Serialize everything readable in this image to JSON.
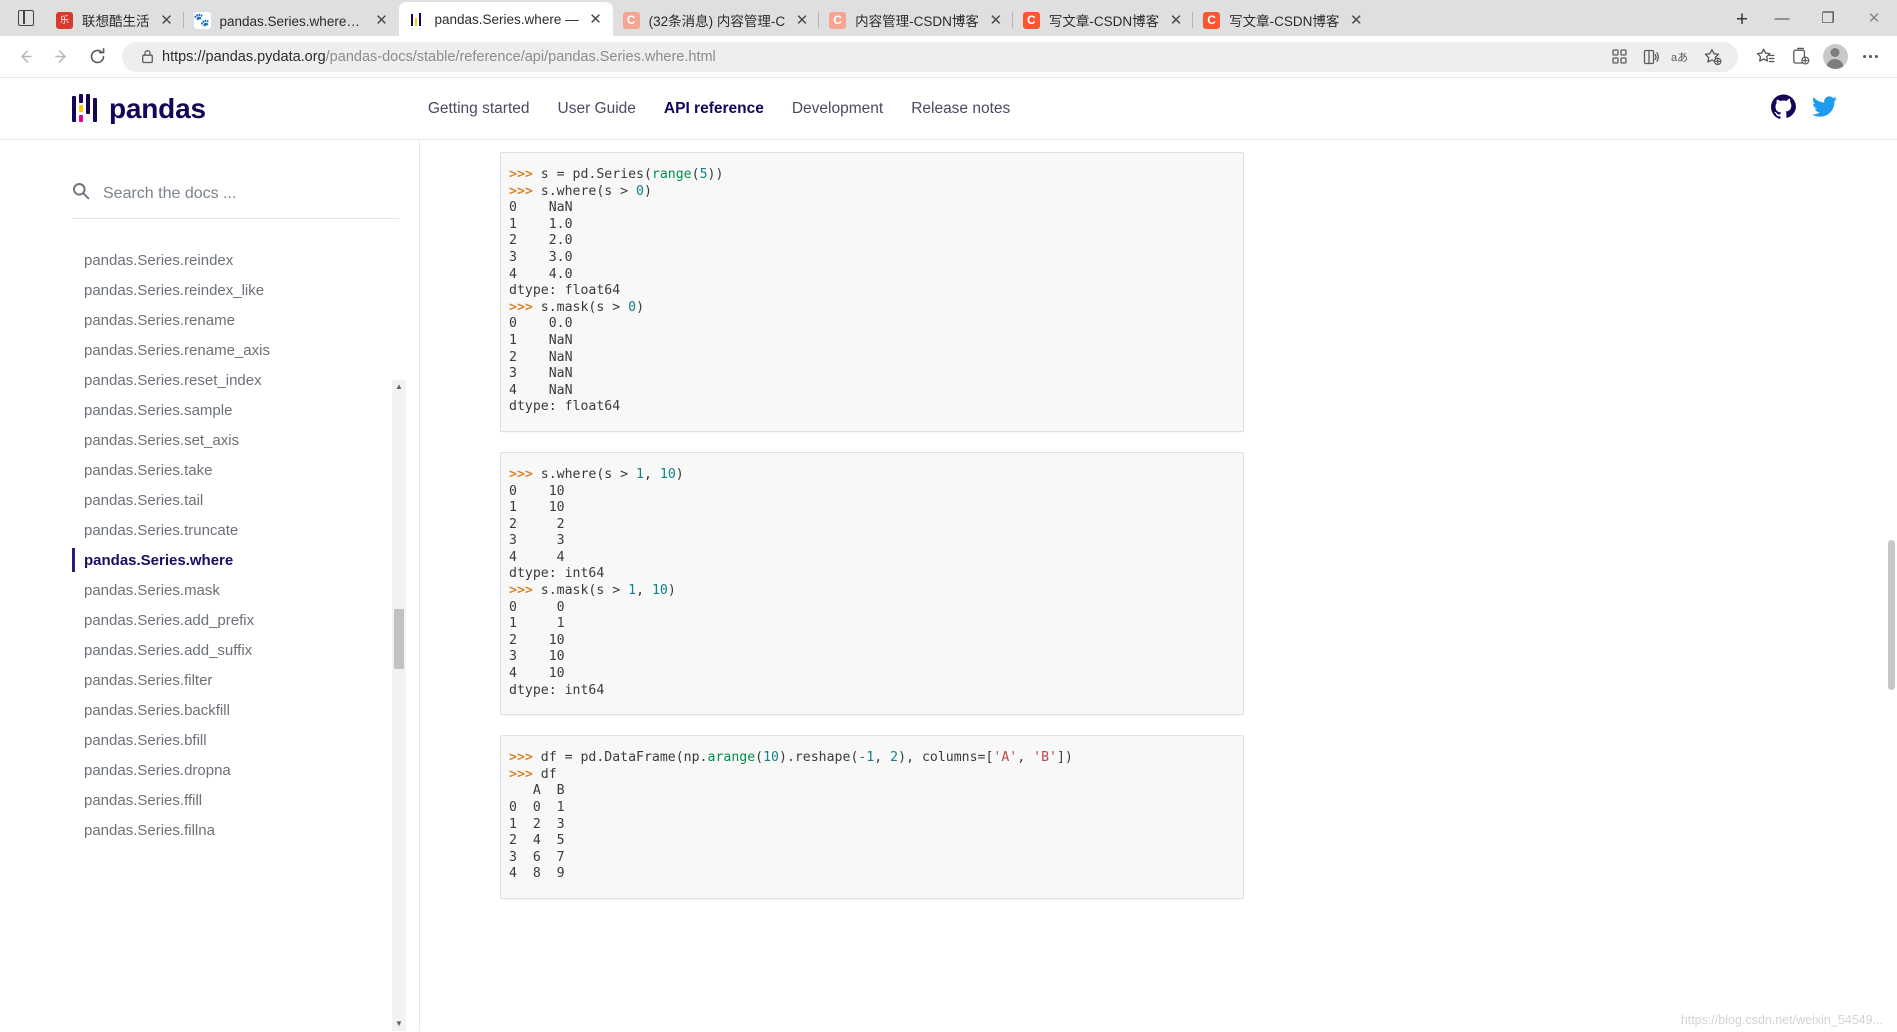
{
  "browser": {
    "tabs": [
      {
        "title": "联想酷生活",
        "favicon": "lenovo-icon",
        "active": false
      },
      {
        "title": "pandas.Series.where_百",
        "favicon": "baidu-icon",
        "active": false
      },
      {
        "title": "pandas.Series.where —",
        "favicon": "pandas-icon",
        "active": true
      },
      {
        "title": "(32条消息) 内容管理-C",
        "favicon": "csdn-pale-icon",
        "active": false
      },
      {
        "title": "内容管理-CSDN博客",
        "favicon": "csdn-pale-icon",
        "active": false
      },
      {
        "title": "写文章-CSDN博客",
        "favicon": "csdn-icon",
        "active": false
      },
      {
        "title": "写文章-CSDN博客",
        "favicon": "csdn-icon",
        "active": false
      }
    ],
    "tab_close_label": "✕",
    "new_tab_label": "+",
    "window_controls": {
      "minimize": "—",
      "maximize": "❐",
      "close": "✕"
    },
    "nav": {
      "back": "←",
      "forward": "→",
      "reload": "⟳"
    },
    "address": {
      "host": "https://pandas.pydata.org",
      "path": "/pandas-docs/stable/reference/api/pandas.Series.where.html",
      "full": "https://pandas.pydata.org/pandas-docs/stable/reference/api/pandas.Series.where.html"
    },
    "toolbar_icons": [
      "qr-code-icon",
      "read-aloud-icon",
      "translate-icon",
      "add-favorite-icon",
      "favorites-icon",
      "collections-icon",
      "profile-icon",
      "more-options-icon"
    ]
  },
  "site": {
    "logo_text": "pandas",
    "nav": [
      {
        "label": "Getting started",
        "active": false
      },
      {
        "label": "User Guide",
        "active": false
      },
      {
        "label": "API reference",
        "active": true
      },
      {
        "label": "Development",
        "active": false
      },
      {
        "label": "Release notes",
        "active": false
      }
    ],
    "social": [
      "github-icon",
      "twitter-icon"
    ]
  },
  "sidebar": {
    "search": {
      "placeholder": "Search the docs ...",
      "value": ""
    },
    "items": [
      {
        "label": "pandas.Series.reindex",
        "active": false
      },
      {
        "label": "pandas.Series.reindex_like",
        "active": false
      },
      {
        "label": "pandas.Series.rename",
        "active": false
      },
      {
        "label": "pandas.Series.rename_axis",
        "active": false
      },
      {
        "label": "pandas.Series.reset_index",
        "active": false
      },
      {
        "label": "pandas.Series.sample",
        "active": false
      },
      {
        "label": "pandas.Series.set_axis",
        "active": false
      },
      {
        "label": "pandas.Series.take",
        "active": false
      },
      {
        "label": "pandas.Series.tail",
        "active": false
      },
      {
        "label": "pandas.Series.truncate",
        "active": false
      },
      {
        "label": "pandas.Series.where",
        "active": true
      },
      {
        "label": "pandas.Series.mask",
        "active": false
      },
      {
        "label": "pandas.Series.add_prefix",
        "active": false
      },
      {
        "label": "pandas.Series.add_suffix",
        "active": false
      },
      {
        "label": "pandas.Series.filter",
        "active": false
      },
      {
        "label": "pandas.Series.backfill",
        "active": false
      },
      {
        "label": "pandas.Series.bfill",
        "active": false
      },
      {
        "label": "pandas.Series.dropna",
        "active": false
      },
      {
        "label": "pandas.Series.ffill",
        "active": false
      },
      {
        "label": "pandas.Series.fillna",
        "active": false
      }
    ],
    "scroll_up_arrow": "▲",
    "scroll_down_arrow": "▼"
  },
  "main": {
    "code_blocks": [
      {
        "id": "example-where-mask-nan",
        "lines": [
          [
            {
              "t": ">>> ",
              "c": "cb-prompt"
            },
            {
              "t": "s = pd.Series(",
              "c": "cb-op"
            },
            {
              "t": "range",
              "c": "cb-fn"
            },
            {
              "t": "(",
              "c": "cb-op"
            },
            {
              "t": "5",
              "c": "cb-num"
            },
            {
              "t": "))",
              "c": "cb-op"
            }
          ],
          [
            {
              "t": ">>> ",
              "c": "cb-prompt"
            },
            {
              "t": "s.where(s > ",
              "c": "cb-op"
            },
            {
              "t": "0",
              "c": "cb-num"
            },
            {
              "t": ")",
              "c": "cb-op"
            }
          ],
          [
            {
              "t": "0    NaN",
              "c": "cb-op"
            }
          ],
          [
            {
              "t": "1    1.0",
              "c": "cb-op"
            }
          ],
          [
            {
              "t": "2    2.0",
              "c": "cb-op"
            }
          ],
          [
            {
              "t": "3    3.0",
              "c": "cb-op"
            }
          ],
          [
            {
              "t": "4    4.0",
              "c": "cb-op"
            }
          ],
          [
            {
              "t": "dtype: float64",
              "c": "cb-op"
            }
          ],
          [
            {
              "t": ">>> ",
              "c": "cb-prompt"
            },
            {
              "t": "s.mask(s > ",
              "c": "cb-op"
            },
            {
              "t": "0",
              "c": "cb-num"
            },
            {
              "t": ")",
              "c": "cb-op"
            }
          ],
          [
            {
              "t": "0    0.0",
              "c": "cb-op"
            }
          ],
          [
            {
              "t": "1    NaN",
              "c": "cb-op"
            }
          ],
          [
            {
              "t": "2    NaN",
              "c": "cb-op"
            }
          ],
          [
            {
              "t": "3    NaN",
              "c": "cb-op"
            }
          ],
          [
            {
              "t": "4    NaN",
              "c": "cb-op"
            }
          ],
          [
            {
              "t": "dtype: float64",
              "c": "cb-op"
            }
          ]
        ]
      },
      {
        "id": "example-where-mask-other",
        "lines": [
          [
            {
              "t": ">>> ",
              "c": "cb-prompt"
            },
            {
              "t": "s.where(s > ",
              "c": "cb-op"
            },
            {
              "t": "1",
              "c": "cb-num"
            },
            {
              "t": ", ",
              "c": "cb-op"
            },
            {
              "t": "10",
              "c": "cb-num"
            },
            {
              "t": ")",
              "c": "cb-op"
            }
          ],
          [
            {
              "t": "0    10",
              "c": "cb-op"
            }
          ],
          [
            {
              "t": "1    10",
              "c": "cb-op"
            }
          ],
          [
            {
              "t": "2     2",
              "c": "cb-op"
            }
          ],
          [
            {
              "t": "3     3",
              "c": "cb-op"
            }
          ],
          [
            {
              "t": "4     4",
              "c": "cb-op"
            }
          ],
          [
            {
              "t": "dtype: int64",
              "c": "cb-op"
            }
          ],
          [
            {
              "t": ">>> ",
              "c": "cb-prompt"
            },
            {
              "t": "s.mask(s > ",
              "c": "cb-op"
            },
            {
              "t": "1",
              "c": "cb-num"
            },
            {
              "t": ", ",
              "c": "cb-op"
            },
            {
              "t": "10",
              "c": "cb-num"
            },
            {
              "t": ")",
              "c": "cb-op"
            }
          ],
          [
            {
              "t": "0     0",
              "c": "cb-op"
            }
          ],
          [
            {
              "t": "1     1",
              "c": "cb-op"
            }
          ],
          [
            {
              "t": "2    10",
              "c": "cb-op"
            }
          ],
          [
            {
              "t": "3    10",
              "c": "cb-op"
            }
          ],
          [
            {
              "t": "4    10",
              "c": "cb-op"
            }
          ],
          [
            {
              "t": "dtype: int64",
              "c": "cb-op"
            }
          ]
        ]
      },
      {
        "id": "example-dataframe",
        "lines": [
          [
            {
              "t": ">>> ",
              "c": "cb-prompt"
            },
            {
              "t": "df = pd.DataFrame(np.",
              "c": "cb-op"
            },
            {
              "t": "arange",
              "c": "cb-fn"
            },
            {
              "t": "(",
              "c": "cb-op"
            },
            {
              "t": "10",
              "c": "cb-num"
            },
            {
              "t": ").reshape(",
              "c": "cb-op"
            },
            {
              "t": "-1",
              "c": "cb-num"
            },
            {
              "t": ", ",
              "c": "cb-op"
            },
            {
              "t": "2",
              "c": "cb-num"
            },
            {
              "t": "), columns=[",
              "c": "cb-op"
            },
            {
              "t": "'A'",
              "c": "cb-str"
            },
            {
              "t": ", ",
              "c": "cb-op"
            },
            {
              "t": "'B'",
              "c": "cb-str"
            },
            {
              "t": "])",
              "c": "cb-op"
            }
          ],
          [
            {
              "t": ">>> ",
              "c": "cb-prompt"
            },
            {
              "t": "df",
              "c": "cb-op"
            }
          ],
          [
            {
              "t": "   A  B",
              "c": "cb-op"
            }
          ],
          [
            {
              "t": "0  0  1",
              "c": "cb-op"
            }
          ],
          [
            {
              "t": "1  2  3",
              "c": "cb-op"
            }
          ],
          [
            {
              "t": "2  4  5",
              "c": "cb-op"
            }
          ],
          [
            {
              "t": "3  6  7",
              "c": "cb-op"
            }
          ],
          [
            {
              "t": "4  8  9",
              "c": "cb-op"
            }
          ]
        ]
      }
    ]
  },
  "watermark": "https://blog.csdn.net/weixin_54549..."
}
